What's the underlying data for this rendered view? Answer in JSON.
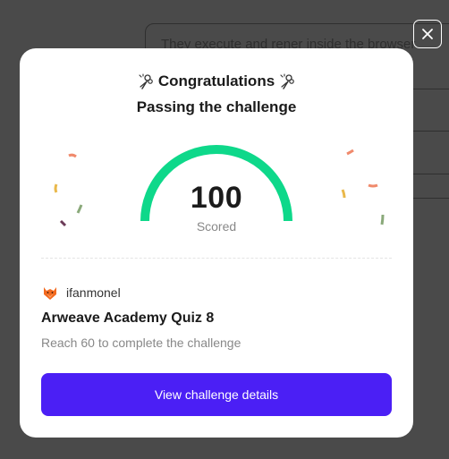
{
  "background": {
    "question_text": "They execute and rener inside the browser"
  },
  "close_button": {
    "icon": "close-icon"
  },
  "modal": {
    "title": "Congratulations",
    "subtitle": "Passing the challenge",
    "title_icon": "bouquet-icon",
    "score": "100",
    "score_label": "Scored",
    "score_fraction": 1.0,
    "user": {
      "name": "ifanmonel",
      "avatar_icon": "orange-fox-avatar"
    },
    "quiz_title": "Arweave Academy Quiz 8",
    "quiz_description": "Reach 60 to complete the challenge",
    "cta_label": "View challenge details"
  },
  "colors": {
    "gauge": "#0ed88a",
    "cta": "#4b1ff5",
    "overlay": "#4a4a4a"
  }
}
